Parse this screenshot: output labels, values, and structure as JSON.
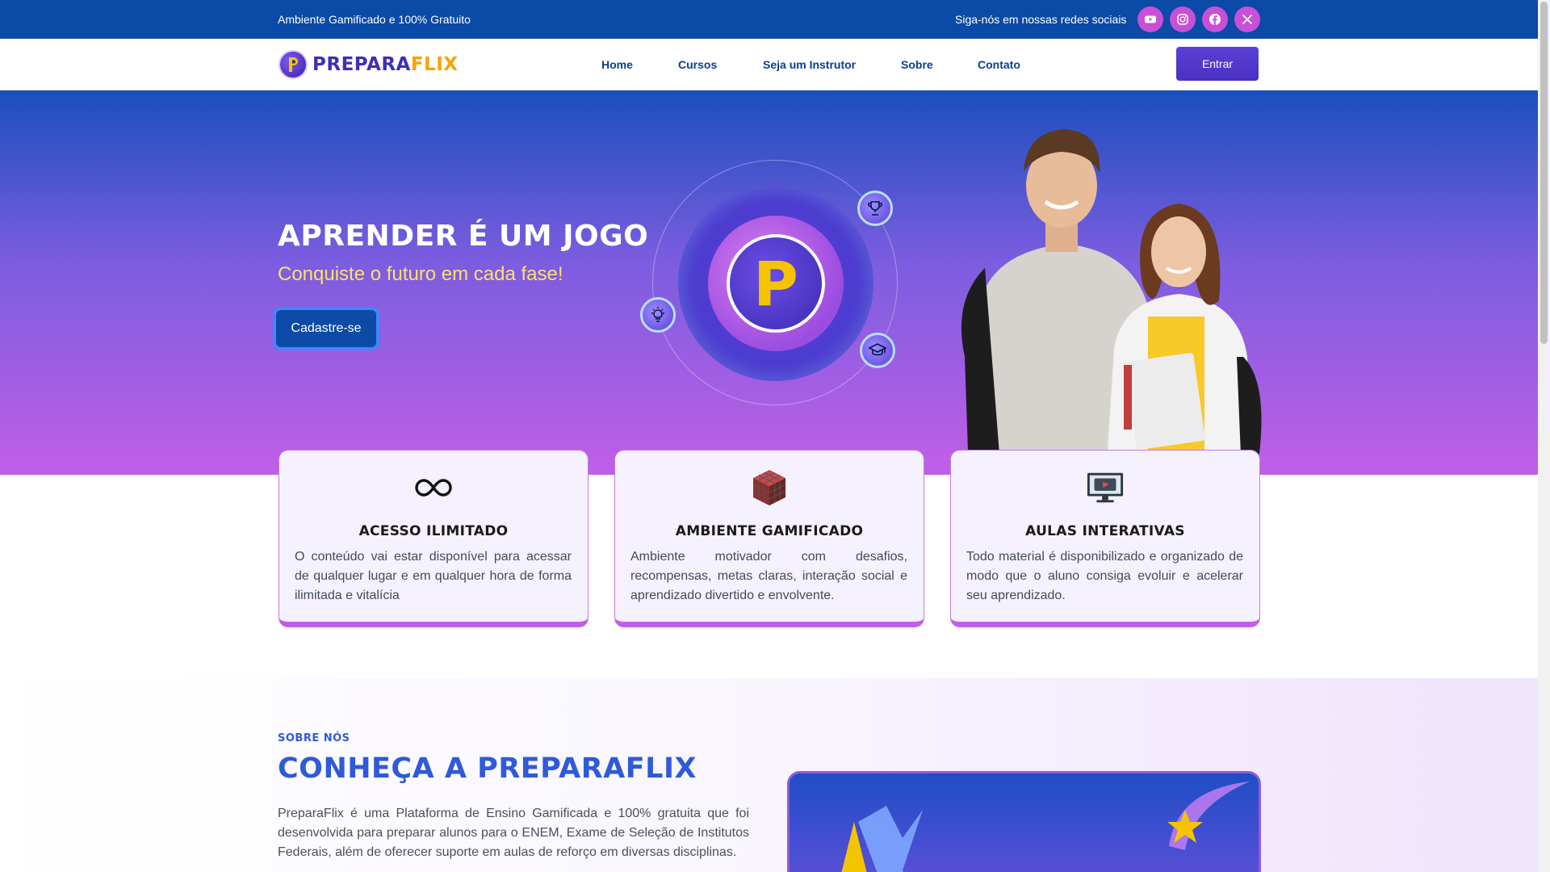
{
  "topbar": {
    "promo": "Ambiente Gamificado e 100% Gratuito",
    "social_label": "Siga-nós em nossas redes sociais",
    "social_icons": [
      "youtube-icon",
      "instagram-icon",
      "facebook-icon",
      "x-icon"
    ]
  },
  "nav": {
    "logo_part1": "PREPARA",
    "logo_part2": "FLIX",
    "links": [
      "Home",
      "Cursos",
      "Seja um Instrutor",
      "Sobre",
      "Contato"
    ],
    "login": "Entrar"
  },
  "hero": {
    "title": "APRENDER É UM JOGO",
    "subtitle": "Conquiste o futuro em cada fase!",
    "cta": "Cadastre-se",
    "emblem_letter": "P",
    "floating_icons": [
      "trophy-icon",
      "lightbulb-icon",
      "graduation-cap-icon"
    ]
  },
  "features": [
    {
      "icon": "infinity-icon",
      "title": "ACESSO ILIMITADO",
      "description": "O conteúdo vai estar disponível para acessar de qualquer lugar e em qualquer hora de forma ilimitada e vitalícia"
    },
    {
      "icon": "rubiks-cube-icon",
      "title": "AMBIENTE GAMIFICADO",
      "description": "Ambiente motivador com desafios, recompensas, metas claras, interação social e aprendizado divertido e envolvente."
    },
    {
      "icon": "monitor-play-icon",
      "title": "AULAS INTERATIVAS",
      "description": "Todo material é disponibilizado e organizado de modo que o aluno consiga evoluir e acelerar seu aprendizado."
    }
  ],
  "about": {
    "kicker": "SOBRE NÓS",
    "heading": "CONHEÇA A PREPARAFLIX",
    "text": "PreparaFlix é uma Plataforma de Ensino Gamificada e 100% gratuita que foi desenvolvida para preparar alunos para o ENEM, Exame de Seleção de Institutos Federais, além de oferecer suporte em aulas de reforço em diversas disciplinas."
  },
  "colors": {
    "primary_blue": "#0b4aa6",
    "accent_purple": "#c05fe6",
    "accent_yellow": "#ffe066",
    "heading_blue": "#2f5ad8"
  }
}
